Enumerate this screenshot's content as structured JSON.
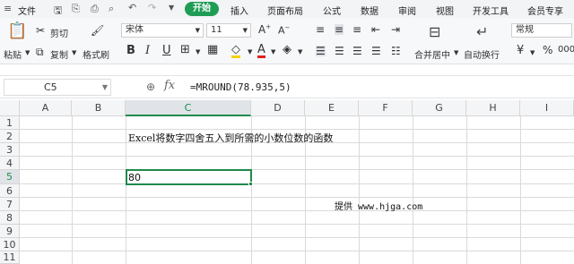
{
  "menubar": {
    "items": [
      "文件",
      "开始",
      "插入",
      "页面布局",
      "公式",
      "数据",
      "审阅",
      "视图",
      "开发工具",
      "会员专享"
    ],
    "active": "开始",
    "accent": "#1f9d55"
  },
  "ribbon": {
    "paste": "粘贴",
    "cut": "剪切",
    "copy": "复制",
    "format_painter": "格式刷",
    "font_name": "宋体",
    "font_size": "11",
    "merge_center": "合并居中",
    "wrap_text": "自动换行",
    "number_format": "常规",
    "currency": "¥",
    "percent": "%",
    "comma": "000"
  },
  "formula_bar": {
    "name_box": "C5",
    "formula": "=MROUND(78.935,5)"
  },
  "sheet": {
    "columns": [
      "A",
      "B",
      "C",
      "D",
      "E",
      "F",
      "G",
      "H",
      "I"
    ],
    "rows": [
      "1",
      "2",
      "3",
      "4",
      "5",
      "6",
      "7",
      "8",
      "9",
      "10",
      "11"
    ],
    "selected_cell": "C5",
    "c2": "Excel将数字四舍五入到所需的小数位数的函数",
    "c5": "80",
    "e7": "提供 www.hjga.com"
  }
}
